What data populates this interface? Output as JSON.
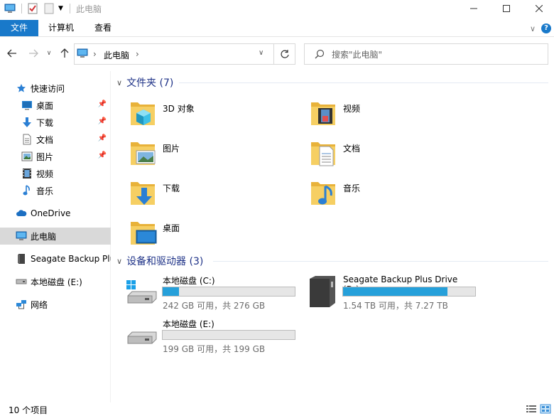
{
  "window": {
    "title": "此电脑",
    "minimize_icon": "minimize-icon",
    "maximize_icon": "maximize-icon",
    "close_icon": "close-icon"
  },
  "ribbon": {
    "tabs": [
      {
        "label": "文件",
        "active": true
      },
      {
        "label": "计算机"
      },
      {
        "label": "查看"
      }
    ],
    "help_label": "?"
  },
  "address": {
    "segments": [
      "此电脑"
    ],
    "search_placeholder": "搜索\"此电脑\""
  },
  "sidebar": {
    "quick_access": "快速访问",
    "quick_items": [
      {
        "label": "桌面",
        "icon": "desktop-icon",
        "pinned": true
      },
      {
        "label": "下载",
        "icon": "download-icon",
        "pinned": true
      },
      {
        "label": "文档",
        "icon": "document-icon",
        "pinned": true
      },
      {
        "label": "图片",
        "icon": "picture-icon",
        "pinned": true
      },
      {
        "label": "视频",
        "icon": "video-icon",
        "pinned": false
      },
      {
        "label": "音乐",
        "icon": "music-icon",
        "pinned": false
      }
    ],
    "onedrive": "OneDrive",
    "this_pc": "此电脑",
    "seagate": "Seagate Backup Plus",
    "local_disk": "本地磁盘 (E:)",
    "network": "网络"
  },
  "folders_group": {
    "title": "文件夹 (7)",
    "items": [
      {
        "label": "3D 对象",
        "icon": "3d-objects-icon"
      },
      {
        "label": "视频",
        "icon": "videos-folder-icon"
      },
      {
        "label": "图片",
        "icon": "pictures-folder-icon"
      },
      {
        "label": "文档",
        "icon": "documents-folder-icon"
      },
      {
        "label": "下载",
        "icon": "downloads-folder-icon"
      },
      {
        "label": "音乐",
        "icon": "music-folder-icon"
      },
      {
        "label": "桌面",
        "icon": "desktop-folder-icon"
      }
    ]
  },
  "drives_group": {
    "title": "设备和驱动器 (3)",
    "items": [
      {
        "label": "本地磁盘 (C:)",
        "size": "242 GB 可用，共 276 GB",
        "used_fraction": 0.123,
        "icon": "windows-drive-icon"
      },
      {
        "label": "Seagate Backup Plus Drive (D:)",
        "size": "1.54 TB 可用，共 7.27 TB",
        "used_fraction": 0.788,
        "icon": "external-drive-icon"
      },
      {
        "label": "本地磁盘 (E:)",
        "size": "199 GB 可用，共 199 GB",
        "used_fraction": 0.0,
        "icon": "local-drive-icon"
      }
    ]
  },
  "status": {
    "count": "10 个项目"
  },
  "colors": {
    "accent": "#1979ca",
    "bar_fill": "#26a0da",
    "group_title": "#1e3287",
    "selected_bg": "#d9d9d9"
  }
}
